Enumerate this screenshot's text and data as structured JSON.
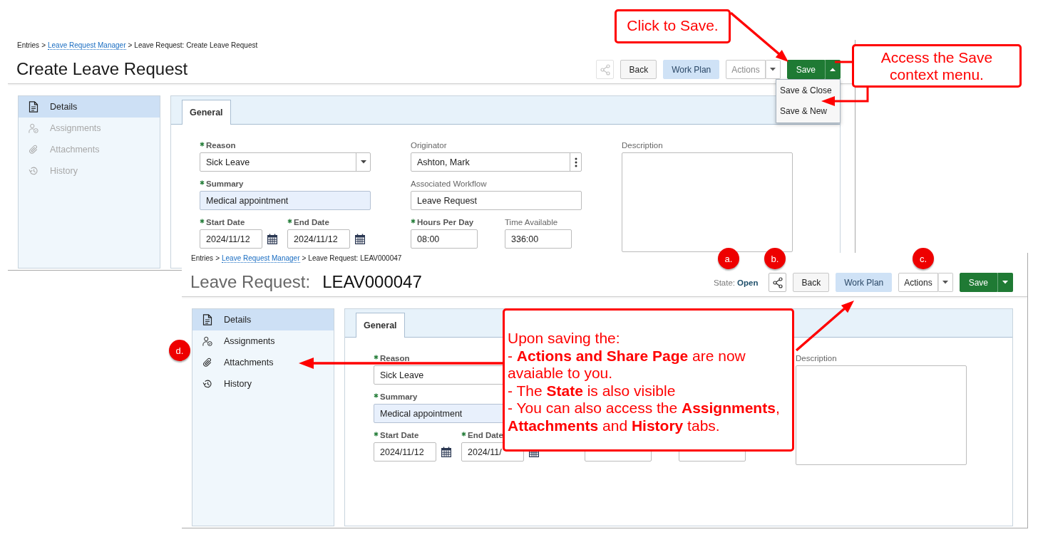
{
  "screens": [
    {
      "breadcrumb": {
        "separator": ">",
        "items": [
          {
            "label": "Entries",
            "link": false
          },
          {
            "label": "Leave Request Manager",
            "link": true
          },
          {
            "label": "Leave Request: Create Leave Request",
            "link": false
          }
        ]
      },
      "title": "Create Leave Request",
      "toolbar": [
        {
          "kind": "share",
          "disabled": true
        },
        {
          "kind": "back",
          "label": "Back"
        },
        {
          "kind": "plan",
          "label": "Work Plan"
        },
        {
          "kind": "actions",
          "label": "Actions",
          "disabled": true
        },
        {
          "kind": "save",
          "label": "Save",
          "expanded": true,
          "menu": [
            {
              "label": "Save & Close"
            },
            {
              "label": "Save & New"
            }
          ]
        }
      ],
      "sidebar": [
        {
          "label": "Details",
          "selected": true,
          "disabled": false
        },
        {
          "label": "Assignments",
          "selected": false,
          "disabled": true
        },
        {
          "label": "Attachments",
          "selected": false,
          "disabled": true
        },
        {
          "label": "History",
          "selected": false,
          "disabled": true
        }
      ],
      "tabs": [
        {
          "label": "General",
          "selected": true
        }
      ],
      "form": {
        "columns": [
          {
            "rows": [
              {
                "fields": [
                  {
                    "label": "Reason",
                    "required": true,
                    "kind": "select",
                    "value": "Sick Leave"
                  }
                ]
              },
              {
                "fields": [
                  {
                    "label": "Summary",
                    "required": true,
                    "kind": "text",
                    "value": "Medical appointment",
                    "highlighted": true
                  }
                ]
              },
              {
                "fields": [
                  {
                    "label": "Start Date",
                    "required": true,
                    "kind": "date",
                    "value": "2024/11/12"
                  },
                  {
                    "label": "End Date",
                    "required": true,
                    "kind": "date",
                    "value": "2024/11/12"
                  }
                ]
              }
            ]
          },
          {
            "rows": [
              {
                "fields": [
                  {
                    "label": "Originator",
                    "required": false,
                    "kind": "lookup",
                    "value": "Ashton, Mark"
                  }
                ]
              },
              {
                "fields": [
                  {
                    "label": "Associated Workflow",
                    "required": false,
                    "kind": "text",
                    "value": "Leave Request",
                    "highlighted": false
                  }
                ]
              },
              {
                "fields": [
                  {
                    "label": "Hours Per Day",
                    "required": true,
                    "kind": "short",
                    "value": "08:00"
                  },
                  {
                    "label": "Time Available",
                    "required": false,
                    "kind": "short",
                    "value": "336:00"
                  }
                ]
              }
            ]
          },
          {
            "rows": [
              {
                "fields": [
                  {
                    "label": "Description",
                    "required": false,
                    "kind": "textarea"
                  }
                ]
              }
            ]
          }
        ]
      }
    },
    {
      "breadcrumb": {
        "separator": ">",
        "items": [
          {
            "label": "Entries",
            "link": false
          },
          {
            "label": "Leave Request Manager",
            "link": true
          },
          {
            "label": "Leave Request: LEAV000047",
            "link": false
          }
        ]
      },
      "title": "Leave Request:",
      "record_id": "LEAV000047",
      "state": {
        "label": "State:",
        "value": "Open"
      },
      "toolbar": [
        {
          "kind": "share",
          "disabled": false
        },
        {
          "kind": "back",
          "label": "Back"
        },
        {
          "kind": "plan",
          "label": "Work Plan"
        },
        {
          "kind": "actions",
          "label": "Actions",
          "disabled": false
        },
        {
          "kind": "save",
          "label": "Save",
          "expanded": false
        }
      ],
      "sidebar": [
        {
          "label": "Details",
          "selected": true,
          "disabled": false
        },
        {
          "label": "Assignments",
          "selected": false,
          "disabled": false
        },
        {
          "label": "Attachments",
          "selected": false,
          "disabled": false
        },
        {
          "label": "History",
          "selected": false,
          "disabled": false
        }
      ],
      "tabs": [
        {
          "label": "General",
          "selected": true
        }
      ],
      "form": {
        "columns": [
          {
            "rows": [
              {
                "fields": [
                  {
                    "label": "Reason",
                    "required": true,
                    "kind": "text",
                    "value": "Sick Leave",
                    "highlighted": false
                  }
                ]
              },
              {
                "fields": [
                  {
                    "label": "Summary",
                    "required": true,
                    "kind": "text",
                    "value": "Medical appointment",
                    "highlighted": true
                  }
                ]
              },
              {
                "fields": [
                  {
                    "label": "Start Date",
                    "required": true,
                    "kind": "date",
                    "value": "2024/11/12"
                  },
                  {
                    "label": "End Date",
                    "required": true,
                    "kind": "date",
                    "value": "2024/11/"
                  }
                ]
              }
            ]
          },
          {
            "rows": [
              {
                "fields": [
                  {
                    "kind": "short"
                  },
                  {
                    "kind": "short"
                  }
                ]
              }
            ]
          },
          {
            "rows": [
              {
                "fields": [
                  {
                    "label": "Description",
                    "required": false,
                    "kind": "textarea"
                  }
                ]
              }
            ]
          }
        ]
      }
    }
  ],
  "callouts": [
    {
      "paragraphs": [
        "Click to Save."
      ]
    },
    {
      "paragraphs": [
        "Access the Save context menu."
      ]
    },
    {
      "paragraphs": [
        "Upon saving the:",
        "- **Actions and Share Page** are now avaiable to you.",
        "- The **State** is also visible",
        "- You can also access the **Assignments**, **Attachments** and **History** tabs."
      ]
    }
  ],
  "markers": [
    {
      "label": "a."
    },
    {
      "label": "b."
    },
    {
      "label": "c."
    },
    {
      "label": "d."
    }
  ]
}
